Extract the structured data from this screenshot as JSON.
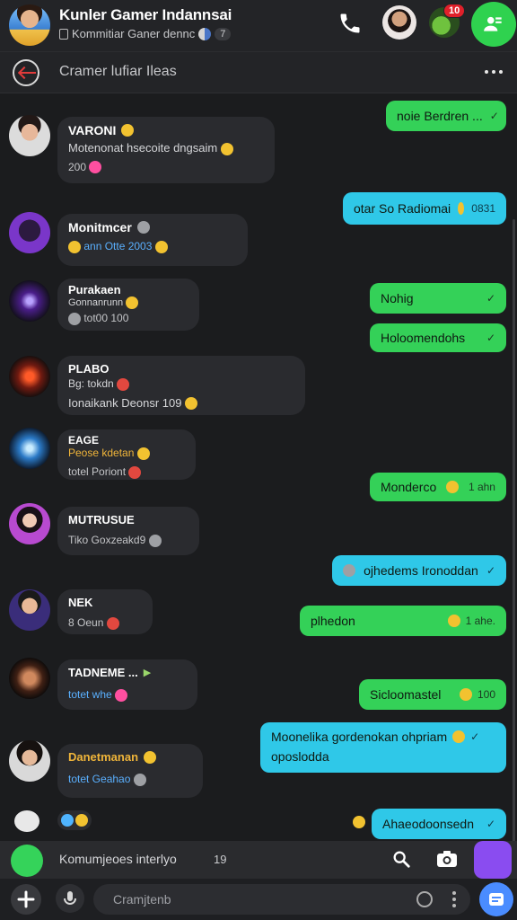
{
  "header": {
    "title": "Kunler Gamer Indannsai",
    "subtitle": "Kommitiar Ganer dennc",
    "member_count": "7",
    "notification_badge": "10"
  },
  "subbar": {
    "title": "Cramer lufiar Ileas"
  },
  "incoming": [
    {
      "name": "VARONI",
      "line": "Motenonat hsecoite dngsaim",
      "meta": "200"
    },
    {
      "name": "Monitmcer",
      "line": "ann Otte 2003",
      "meta": ""
    },
    {
      "name": "Purakaen",
      "line": "Gonnanrunn",
      "meta": "tot00 100"
    },
    {
      "name": "PLABO",
      "line": "Bg: tokdn",
      "meta": "Ionaikank Deonsr 109"
    },
    {
      "name": "EAGE",
      "line": "Peose kdetan",
      "meta": "totel Poriont"
    },
    {
      "name": "MUTRUSUE",
      "line": "Tiko Goxzeakd9",
      "meta": ""
    },
    {
      "name": "NEK",
      "line": "8 Oeun",
      "meta": ""
    },
    {
      "name": "TADNEME ...",
      "line": "totet whe",
      "meta": ""
    },
    {
      "name": "Danetmanan",
      "line": "totet Geahao",
      "meta": ""
    }
  ],
  "outgoing": [
    {
      "text": "noie Berdren ...",
      "time": ""
    },
    {
      "text": "otar So Radiomai",
      "time": "0831"
    },
    {
      "text": "Nohig",
      "time": ""
    },
    {
      "text": "Holoomendohs",
      "time": ""
    },
    {
      "text": "Monderco",
      "time": "1 ahn"
    },
    {
      "text": "ojhedems Ironoddan",
      "time": ""
    },
    {
      "text": "plhedon",
      "time": "1 ahe."
    },
    {
      "text": "Sicloomastel",
      "time": "100"
    },
    {
      "text": "Moonelika gordenokan ohpriam",
      "text2": "oposlodda",
      "time": ""
    },
    {
      "text": "Ahaeodoonsedn",
      "time": ""
    }
  ],
  "composer": {
    "label": "Komumjeoes interlyo",
    "count": "19",
    "placeholder": "Cramjtenb"
  },
  "colors": {
    "accent_green": "#34d158",
    "accent_cyan": "#2fc8e8",
    "background": "#1b1c1e"
  }
}
